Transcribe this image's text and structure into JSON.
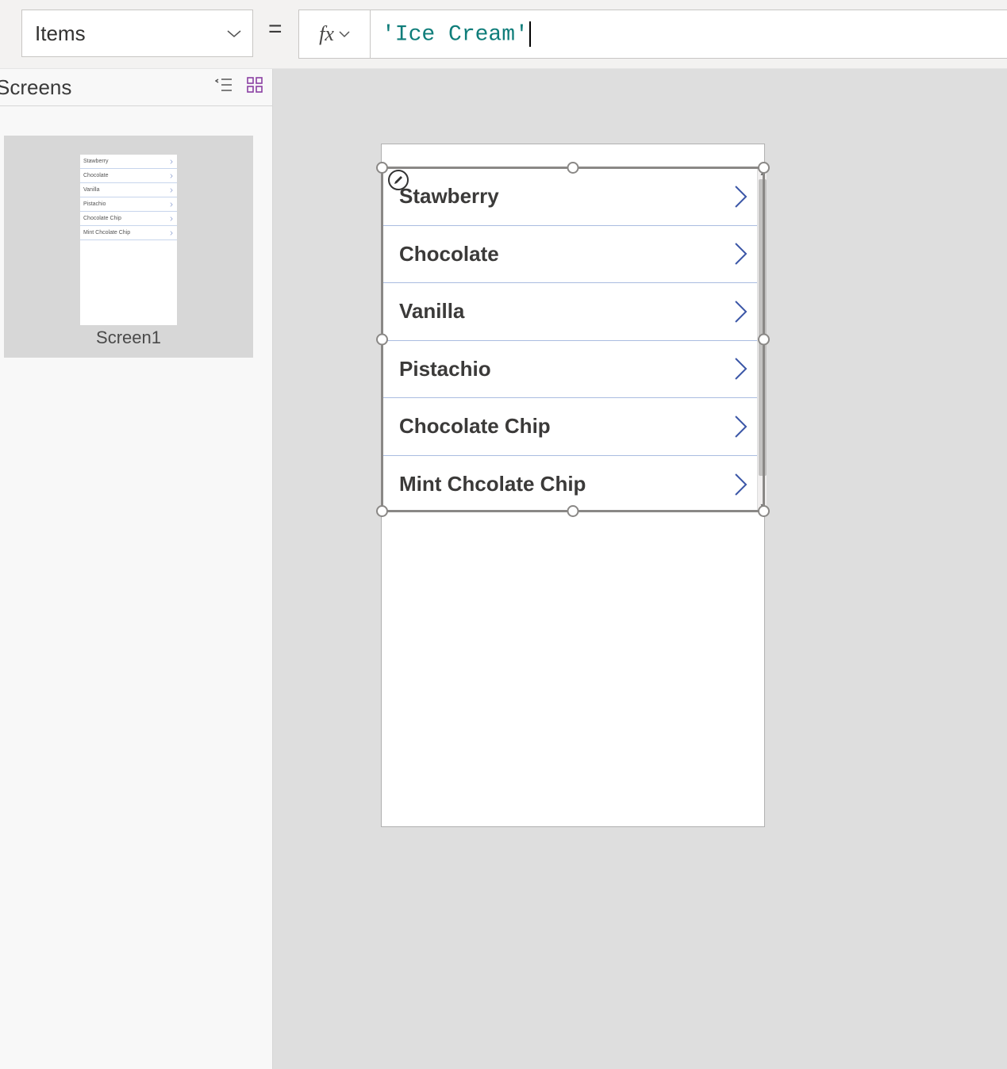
{
  "formula_bar": {
    "property_name": "Items",
    "equals": "=",
    "fx_label": "fx",
    "formula_text": "'Ice Cream'"
  },
  "left_pane": {
    "title": "Screens",
    "thumbnail_label": "Screen1",
    "thumb_items": [
      "Stawberry",
      "Chocolate",
      "Vanilla",
      "Pistachio",
      "Chocolate Chip",
      "Mint Chcolate Chip"
    ]
  },
  "gallery": {
    "items": [
      "Stawberry",
      "Chocolate",
      "Vanilla",
      "Pistachio",
      "Chocolate Chip",
      "Mint Chcolate Chip"
    ]
  },
  "colors": {
    "chevron_blue": "#3b56a7",
    "row_divider": "#aabce0",
    "selection": "#8a8886",
    "formula_green": "#0f7d7a"
  }
}
